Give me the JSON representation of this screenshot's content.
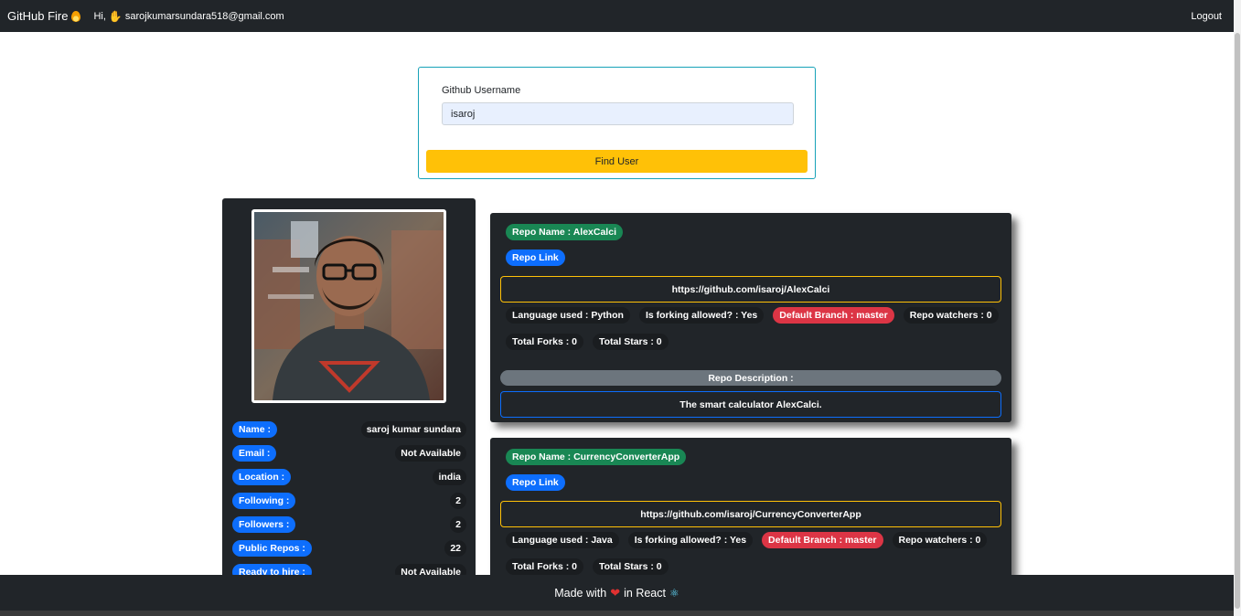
{
  "navbar": {
    "brand": "GitHub Fire",
    "greeting": "Hi,",
    "email": "sarojkumarsundara518@gmail.com",
    "logout": "Logout",
    "brand_icon": "fire-icon",
    "wave_icon": "waving-hand-icon"
  },
  "search": {
    "label": "Github Username",
    "value": "isaroj",
    "button": "Find User"
  },
  "profile": {
    "rows": [
      {
        "label": "Name :",
        "value": "saroj kumar sundara"
      },
      {
        "label": "Email :",
        "value": "Not Available"
      },
      {
        "label": "Location :",
        "value": "india"
      },
      {
        "label": "Following :",
        "value": "2"
      },
      {
        "label": "Followers :",
        "value": "2"
      },
      {
        "label": "Public Repos :",
        "value": "22"
      },
      {
        "label": "Ready to hire :",
        "value": "Not Available"
      }
    ]
  },
  "repos": [
    {
      "name": "Repo Name : AlexCalci",
      "link_label": "Repo Link",
      "url": "https://github.com/isaroj/AlexCalci",
      "language": "Language used : Python",
      "forking": "Is forking allowed? : Yes",
      "branch": "Default Branch : master",
      "watchers": "Repo watchers : 0",
      "forks": "Total Forks : 0",
      "stars": "Total Stars : 0",
      "desc_label": "Repo Description :",
      "description": "The smart calculator AlexCalci."
    },
    {
      "name": "Repo Name : CurrencyConverterApp",
      "link_label": "Repo Link",
      "url": "https://github.com/isaroj/CurrencyConverterApp",
      "language": "Language used : Java",
      "forking": "Is forking allowed? : Yes",
      "branch": "Default Branch : master",
      "watchers": "Repo watchers : 0",
      "forks": "Total Forks : 0",
      "stars": "Total Stars : 0"
    }
  ],
  "footer": {
    "made_with": "Made with",
    "in_react": "in React",
    "heart_icon": "heart-icon",
    "react_icon": "react-atom-icon"
  },
  "colors": {
    "dark": "#212529",
    "primary": "#0d6efd",
    "success": "#198754",
    "danger": "#dc3545",
    "warning": "#ffc107",
    "secondary": "#6c757d",
    "info": "#17a2b8"
  }
}
